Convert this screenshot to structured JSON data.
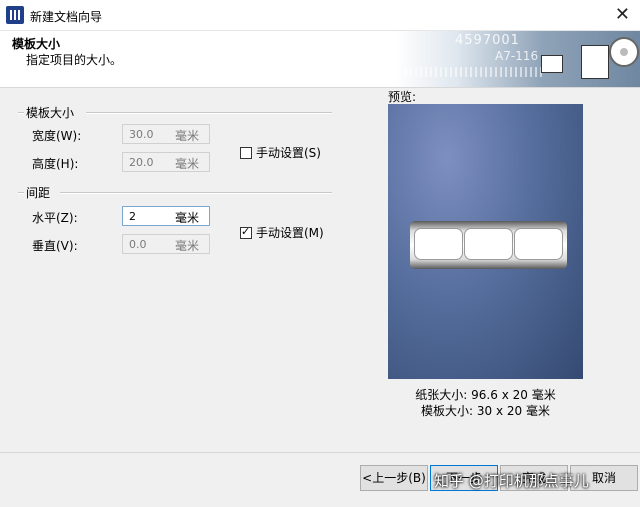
{
  "window": {
    "title": "新建文档向导",
    "close_glyph": "✕"
  },
  "header": {
    "title": "模板大小",
    "subtitle": "指定项目的大小。",
    "banner_num": "4597001",
    "banner_num2": "A7-116"
  },
  "template_size": {
    "group_label": "模板大小",
    "width": {
      "label": "宽度(W):",
      "value": "30.0",
      "unit": "毫米"
    },
    "height": {
      "label": "高度(H):",
      "value": "20.0",
      "unit": "毫米"
    },
    "manual": {
      "label": "手动设置(S)",
      "checked": false
    }
  },
  "spacing": {
    "group_label": "间距",
    "horizontal": {
      "label": "水平(Z):",
      "value": "2",
      "unit": "毫米"
    },
    "vertical": {
      "label": "垂直(V):",
      "value": "0.0",
      "unit": "毫米"
    },
    "manual": {
      "label": "手动设置(M)",
      "checked": true
    }
  },
  "preview": {
    "title": "预览:",
    "paper_size": "纸张大小: 96.6 x 20 毫米",
    "template_size": "模板大小: 30 x 20 毫米",
    "label_count": 3
  },
  "buttons": {
    "back": "<上一步(B)",
    "next": "下一步",
    "finish": "完成",
    "cancel": "取消"
  },
  "watermark": "知乎 @打印机那点事儿"
}
